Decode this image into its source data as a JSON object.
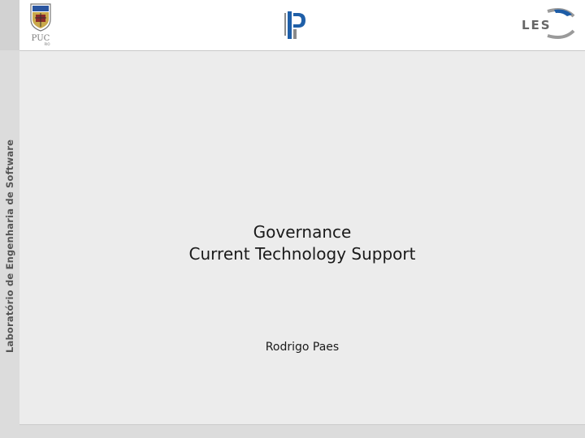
{
  "side_label": "Laboratório de Engenharia de Software",
  "logos": {
    "left": {
      "text": "PUC",
      "subtext": "RIO"
    },
    "center": {
      "icon": "ip-logo-icon"
    },
    "right": {
      "text": "LES"
    }
  },
  "title": {
    "line1": "Governance",
    "line2": "Current Technology Support"
  },
  "author": "Rodrigo Paes",
  "colors": {
    "content_bg": "#ececec",
    "side_band": "#dcdcdc",
    "logo_blue": "#1f5fa8",
    "logo_grey": "#8a8a8a",
    "les_blue": "#1d5ca6"
  }
}
